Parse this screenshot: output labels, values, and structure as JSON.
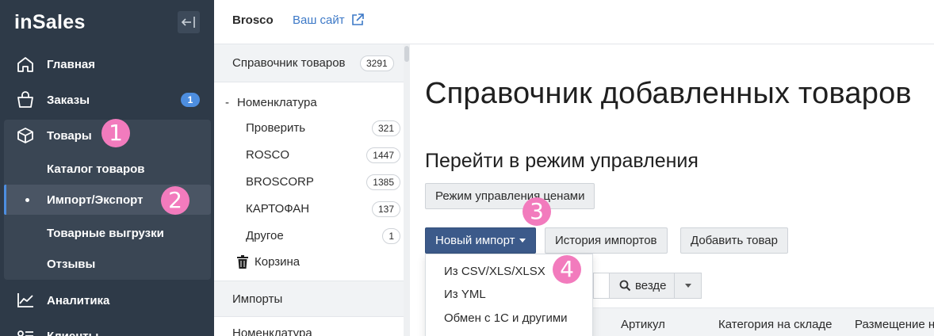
{
  "brand": {
    "logo_text": "inSales"
  },
  "sidebar": {
    "items": [
      {
        "label": "Главная",
        "icon": "home-icon"
      },
      {
        "label": "Заказы",
        "icon": "shopping-bag-icon",
        "badge": "1"
      },
      {
        "label": "Товары",
        "icon": "box-icon"
      },
      {
        "label": "Аналитика",
        "icon": "chart-line-icon"
      },
      {
        "label": "Клиенты",
        "icon": "users-list-icon"
      }
    ],
    "products_submenu": [
      {
        "label": "Каталог товаров"
      },
      {
        "label": "Импорт/Экспорт",
        "active": true
      },
      {
        "label": "Товарные выгрузки"
      },
      {
        "label": "Отзывы"
      }
    ]
  },
  "markers": [
    "1",
    "2",
    "3",
    "4"
  ],
  "topbar": {
    "shop_name": "Brosco",
    "site_link": "Ваш сайт"
  },
  "catalog_panel": {
    "header": {
      "title": "Справочник товаров",
      "count": "3291"
    },
    "tree_root": {
      "toggle": "-",
      "label": "Номенклатура"
    },
    "folders": [
      {
        "label": "Проверить",
        "count": "321"
      },
      {
        "label": "ROSCO",
        "count": "1447"
      },
      {
        "label": "BROSCORP",
        "count": "1385"
      },
      {
        "label": "КАРТОФАН",
        "count": "137"
      },
      {
        "label": "Другое",
        "count": "1"
      }
    ],
    "trash": {
      "label": "Корзина"
    },
    "imports_section": {
      "title": "Импорты"
    },
    "imports_first": {
      "label": "Номенклатура"
    }
  },
  "main": {
    "title": "Справочник добавленных товаров",
    "subheading": "Перейти в режим управления",
    "price_mode_button": "Режим управления ценами",
    "new_import_button": "Новый импорт",
    "history_button": "История импортов",
    "add_product_button": "Добавить товар",
    "import_menu": [
      "Из CSV/XLS/XLSX",
      "Из YML",
      "Обмен с 1С и другими"
    ],
    "search_scope": "везде",
    "table_columns": [
      "Артикул",
      "Категория на складе",
      "Размещение на"
    ]
  },
  "colors": {
    "sidebar_bg": "#2e3a48",
    "accent_blue": "#4d8ee0",
    "primary_button": "#3c5a8a",
    "marker_pink": "#f27bbd",
    "link_blue": "#3d79c7"
  }
}
